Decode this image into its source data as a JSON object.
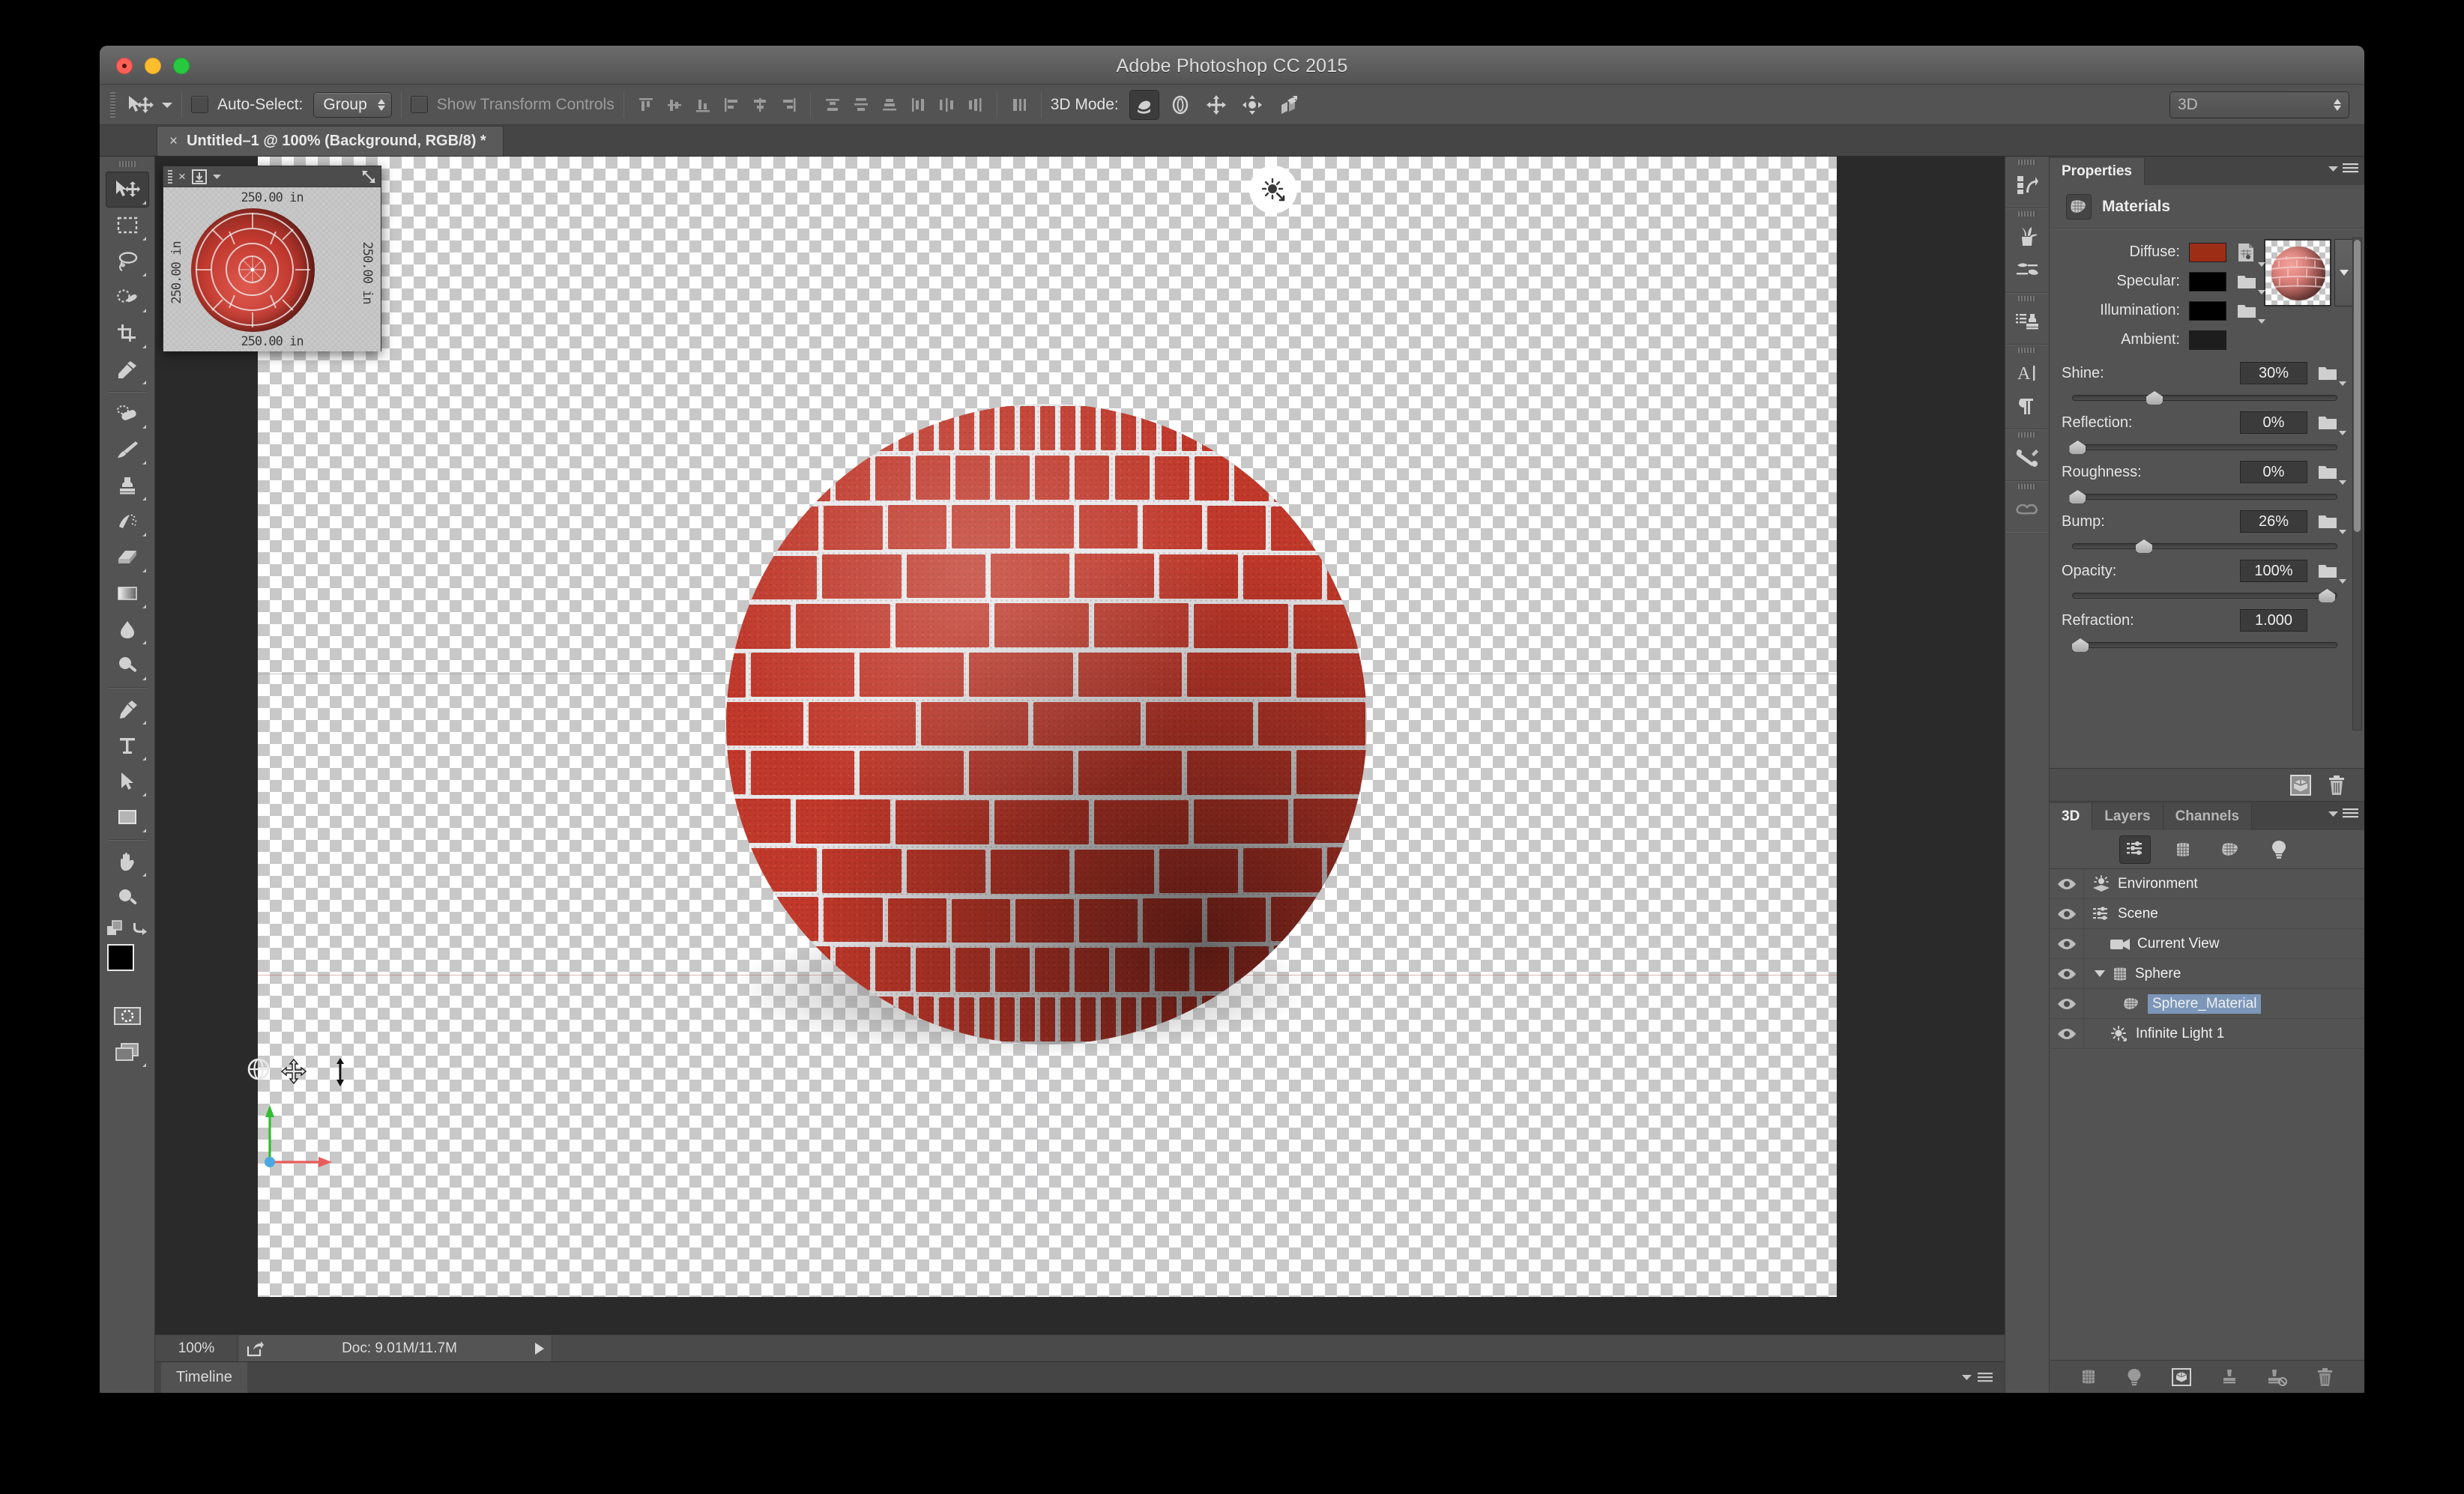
{
  "window": {
    "title": "Adobe Photoshop CC 2015",
    "traffic": [
      "close",
      "minimize",
      "zoom"
    ]
  },
  "options_bar": {
    "tool_icon": "move-tool-icon",
    "auto_select_label": "Auto-Select:",
    "auto_select_value": "Group",
    "auto_select_checked": false,
    "show_transform_label": "Show Transform Controls",
    "show_transform_checked": false,
    "align_icons": [
      "align-top-edges-icon",
      "align-vertical-centers-icon",
      "align-bottom-edges-icon",
      "align-left-edges-icon",
      "align-horizontal-centers-icon",
      "align-right-edges-icon"
    ],
    "distribute_icons": [
      "distribute-top-edges-icon",
      "distribute-vertical-centers-icon",
      "distribute-bottom-edges-icon",
      "distribute-left-edges-icon",
      "distribute-horizontal-centers-icon",
      "distribute-right-edges-icon"
    ],
    "auto_distribute_icon": "auto-distribute-spacing-icon",
    "mode_3d_label": "3D Mode:",
    "mode_3d_icons": [
      "rotate-3d-icon",
      "roll-3d-icon",
      "drag-3d-icon",
      "slide-3d-icon",
      "scale-3d-icon"
    ],
    "mode_3d_active_index": 0,
    "workspace_value": "3D"
  },
  "document_tab": {
    "close_glyph": "×",
    "title": "Untitled–1 @ 100% (Background, RGB/8) *"
  },
  "toolbar": {
    "tools": [
      {
        "name": "move-tool",
        "active": true
      },
      {
        "name": "rectangular-marquee-tool",
        "active": false
      },
      {
        "name": "lasso-tool",
        "active": false
      },
      {
        "name": "quick-selection-tool",
        "active": false
      },
      {
        "name": "crop-tool",
        "active": false
      },
      {
        "name": "eyedropper-tool",
        "active": false
      },
      {
        "name": "spot-healing-brush-tool",
        "active": false
      },
      {
        "name": "brush-tool",
        "active": false
      },
      {
        "name": "clone-stamp-tool",
        "active": false
      },
      {
        "name": "history-brush-tool",
        "active": false
      },
      {
        "name": "eraser-tool",
        "active": false
      },
      {
        "name": "gradient-tool",
        "active": false
      },
      {
        "name": "blur-tool",
        "active": false
      },
      {
        "name": "dodge-tool",
        "active": false
      },
      {
        "name": "pen-tool",
        "active": false
      },
      {
        "name": "horizontal-type-tool",
        "active": false
      },
      {
        "name": "path-selection-tool",
        "active": false
      },
      {
        "name": "rectangle-tool",
        "active": false
      },
      {
        "name": "hand-tool",
        "active": false
      },
      {
        "name": "zoom-tool",
        "active": false
      }
    ],
    "foreground_color": "#000000",
    "background_color": "#ffffff",
    "quick_mask_icon": "quick-mask-mode-icon",
    "screen_mode_icon": "screen-mode-icon",
    "default_colors_icon": "default-colors-icon",
    "swap_colors_icon": "swap-colors-icon"
  },
  "secondary_view": {
    "close_glyph": "×",
    "labels": {
      "top": "250.00 in",
      "bottom": "250.00 in",
      "left": "250.00 in",
      "right": "250.00 in"
    }
  },
  "canvas": {
    "light_gizmo": "infinite-light-gizmo-icon",
    "axis_widget": {
      "orbit_icon": "orbit-camera-icon",
      "pan_icon": "pan-camera-icon",
      "x_axis_color": "#e85b5b",
      "y_axis_color": "#2fbf2f",
      "origin_color": "#4aa8e0"
    }
  },
  "status_bar": {
    "zoom": "100%",
    "share_icon": "share-icon",
    "doc_info": "Doc: 9.01M/11.7M",
    "expand_icon": "expand-arrow-icon"
  },
  "timeline_bar": {
    "tab_label": "Timeline",
    "options_icon": "panel-menu-icon"
  },
  "right_dock": {
    "groups": [
      [
        "history-panel-icon"
      ],
      [
        "brush-presets-panel-icon",
        "brush-panel-icon"
      ],
      [
        "clone-source-panel-icon"
      ],
      [
        "character-panel-icon",
        "paragraph-panel-icon"
      ],
      [
        "tool-presets-panel-icon"
      ],
      [
        "creative-cloud-libraries-icon"
      ]
    ]
  },
  "properties_panel": {
    "tab_label": "Properties",
    "menu_icon": "panel-menu-icon",
    "section_title": "Materials",
    "section_icon": "materials-icon",
    "color_rows": [
      {
        "label": "Diffuse:",
        "color": "#9e2d16",
        "texture_icon": "texture-map-icon"
      },
      {
        "label": "Specular:",
        "color": "#000000",
        "texture_icon": "folder-icon"
      },
      {
        "label": "Illumination:",
        "color": "#000000",
        "texture_icon": "folder-icon"
      },
      {
        "label": "Ambient:",
        "color": "#1d1d1d",
        "texture_icon": null
      }
    ],
    "preview_icon": "material-sphere-preview",
    "sliders": [
      {
        "label": "Shine:",
        "value": "30%",
        "percent": 30,
        "texture_icon": "folder-icon"
      },
      {
        "label": "Reflection:",
        "value": "0%",
        "percent": 0,
        "texture_icon": "folder-icon"
      },
      {
        "label": "Roughness:",
        "value": "0%",
        "percent": 0,
        "texture_icon": "folder-icon"
      },
      {
        "label": "Bump:",
        "value": "26%",
        "percent": 26,
        "texture_icon": "folder-icon"
      },
      {
        "label": "Opacity:",
        "value": "100%",
        "percent": 100,
        "texture_icon": "folder-icon"
      },
      {
        "label": "Refraction:",
        "value": "1.000",
        "percent": 2,
        "texture_icon": null
      }
    ],
    "footer_icons": [
      "new-3d-object-icon",
      "delete-icon"
    ]
  },
  "panel_3d": {
    "tabs": [
      {
        "label": "3D",
        "active": true
      },
      {
        "label": "Layers",
        "active": false
      },
      {
        "label": "Channels",
        "active": false
      }
    ],
    "menu_icon": "panel-menu-icon",
    "filter_icons": [
      {
        "name": "filter-all-icon",
        "active": true
      },
      {
        "name": "filter-meshes-icon",
        "active": false
      },
      {
        "name": "filter-materials-icon",
        "active": false
      },
      {
        "name": "filter-lights-icon",
        "active": false
      }
    ],
    "tree": [
      {
        "label": "Environment",
        "icon": "environment-icon",
        "indent": 0,
        "selected": false,
        "disclosure": null
      },
      {
        "label": "Scene",
        "icon": "scene-icon",
        "indent": 0,
        "selected": false,
        "disclosure": null
      },
      {
        "label": "Current View",
        "icon": "camera-icon",
        "indent": 1,
        "selected": false,
        "disclosure": null
      },
      {
        "label": "Sphere",
        "icon": "mesh-icon",
        "indent": 1,
        "selected": false,
        "disclosure": "open"
      },
      {
        "label": "Sphere_Material",
        "icon": "material-icon",
        "indent": 2,
        "selected": true,
        "disclosure": null
      },
      {
        "label": "Infinite Light 1",
        "icon": "light-icon",
        "indent": 1,
        "selected": false,
        "disclosure": null
      }
    ],
    "footer_icons": [
      "add-mesh-icon",
      "add-light-icon",
      "render-icon",
      "filter-on-icon",
      "filter-off-icon",
      "delete-icon"
    ]
  }
}
